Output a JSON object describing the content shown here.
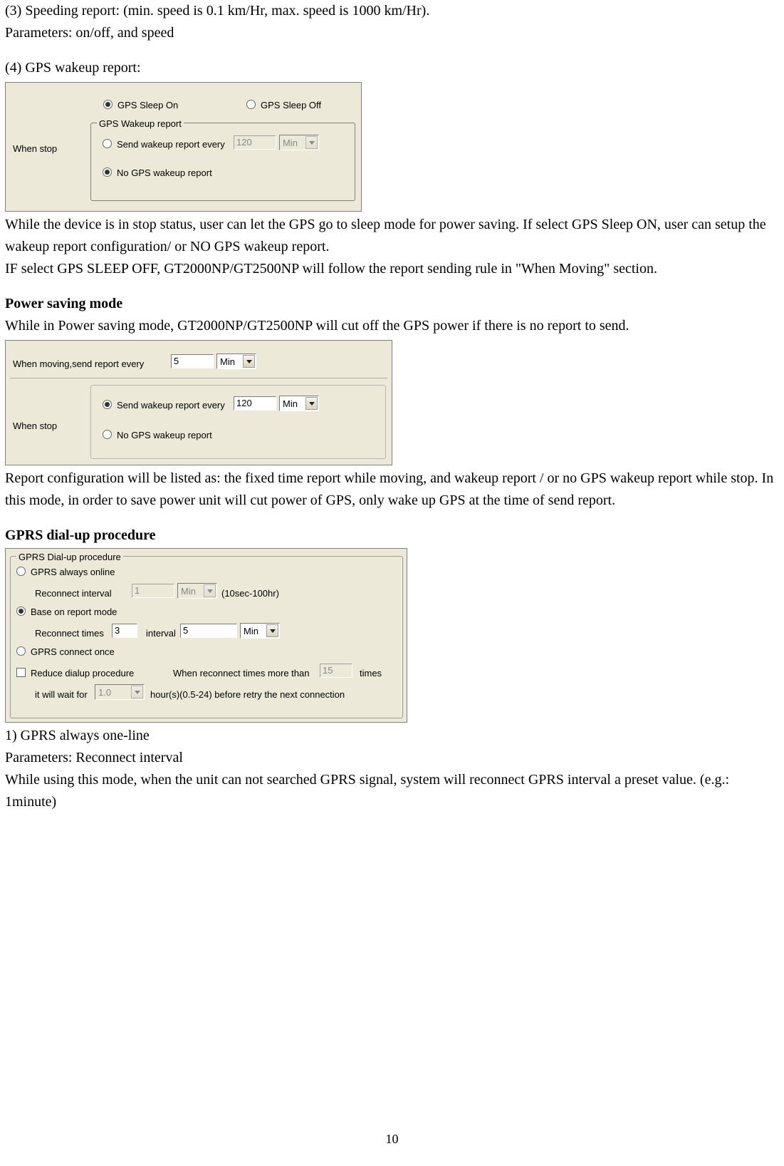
{
  "page_number": "10",
  "text": {
    "p1": "(3) Speeding report: (min. speed is 0.1 km/Hr, max. speed is 1000 km/Hr).",
    "p2": "Parameters: on/off, and speed",
    "p3": "(4) GPS wakeup report:",
    "p4": "While the device is in stop status, user can let the GPS go to sleep mode for power saving. If select GPS Sleep ON, user can setup the wakeup report configuration/ or NO GPS wakeup report.",
    "p5": "IF select GPS SLEEP OFF, GT2000NP/GT2500NP will follow the report sending rule in \"When Moving\" section.",
    "h1": "Power saving mode",
    "p6": "While in Power saving mode, GT2000NP/GT2500NP will cut off the GPS power if there is no report to send.",
    "p7": "Report configuration will be listed as: the fixed time report while moving, and wakeup report / or no GPS wakeup report while stop. In this mode, in order to save power unit will cut power of GPS, only wake up GPS at the time of send report.",
    "h2": "GPRS dial-up procedure",
    "p8": "1) GPRS always one-line",
    "p9": "Parameters: Reconnect interval",
    "p10": "While using this mode, when the unit can not searched GPRS signal, system will reconnect GPRS interval a preset value. (e.g.: 1minute)"
  },
  "panel1": {
    "when_stop_label": "When stop",
    "sleep_on": "GPS Sleep On",
    "sleep_off": "GPS Sleep Off",
    "group_title": "GPS Wakeup report",
    "opt_send": "Send wakeup report every",
    "opt_no": "No GPS wakeup report",
    "interval_value": "120",
    "interval_unit": "Min",
    "selected_sleep": "on",
    "selected_wakeup": "no"
  },
  "panel2": {
    "moving_label": "When moving,send report every",
    "moving_value": "5",
    "moving_unit": "Min",
    "when_stop_label": "When stop",
    "opt_send": "Send wakeup report every",
    "opt_no": "No GPS wakeup report",
    "interval_value": "120",
    "interval_unit": "Min",
    "selected_wakeup": "send"
  },
  "panel3": {
    "group_title": "GPRS Dial-up procedure",
    "opt_always": "GPRS always online",
    "reconnect_interval_label": "Reconnect interval",
    "reconnect_interval_value": "1",
    "reconnect_interval_unit": "Min",
    "reconnect_interval_range": "(10sec-100hr)",
    "opt_base": "Base on report mode",
    "reconnect_times_label": "Reconnect times",
    "reconnect_times_value": "3",
    "interval_label": "interval",
    "interval_value": "5",
    "interval_unit": "Min",
    "opt_once": "GPRS connect once",
    "reduce_label": "Reduce dialup procedure",
    "when_reconnect_more_label": "When reconnect times more than",
    "more_than_value": "15",
    "times_suffix": "times",
    "wait_prefix": "it will wait for",
    "wait_value": "1.0",
    "wait_suffix": "hour(s)(0.5-24) before retry the next connection",
    "selected_mode": "base",
    "reduce_checked": false
  }
}
